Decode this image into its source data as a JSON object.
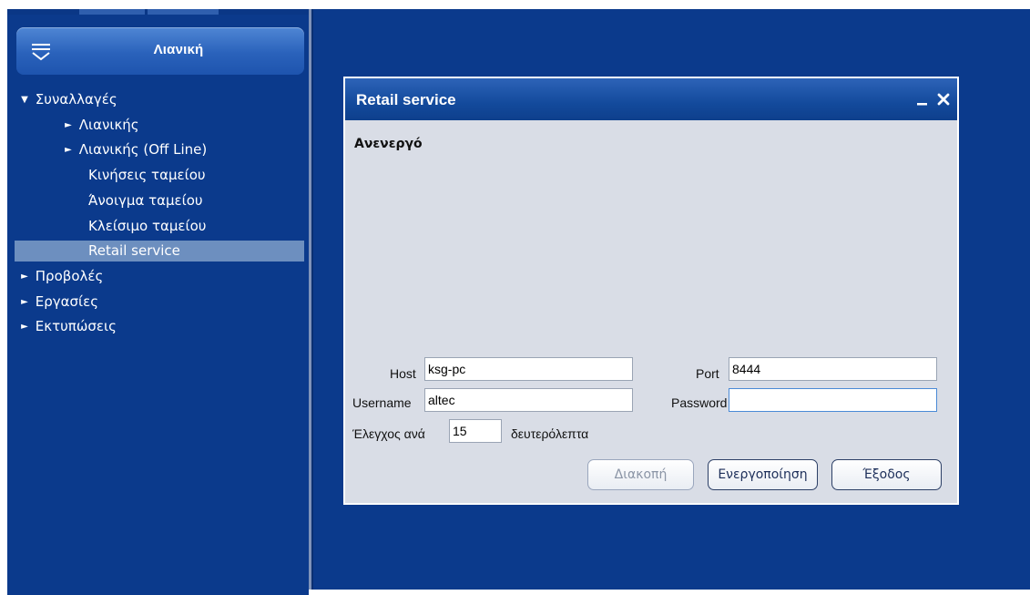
{
  "sidebar": {
    "title": "Λιανική",
    "items": [
      {
        "label": "Συναλλαγές",
        "arrow": "▼"
      },
      {
        "label": "Λιανικής",
        "arrow": "►"
      },
      {
        "label": "Λιανικής (Off Line)",
        "arrow": "►"
      },
      {
        "label": "Κινήσεις ταμείου",
        "arrow": ""
      },
      {
        "label": "Άνοιγμα ταμείου",
        "arrow": ""
      },
      {
        "label": "Κλείσιμο ταμείου",
        "arrow": ""
      },
      {
        "label": "Retail service",
        "arrow": "",
        "selected": true
      },
      {
        "label": "Προβολές",
        "arrow": "►"
      },
      {
        "label": "Εργασίες",
        "arrow": "►"
      },
      {
        "label": "Εκτυπώσεις",
        "arrow": "►"
      }
    ]
  },
  "dialog": {
    "title": "Retail service",
    "minimize_glyph": "_",
    "close_glyph": "✕",
    "status": "Ανενεργό",
    "host_label": "Host",
    "host_value": "ksg-pc",
    "port_label": "Port",
    "port_value": "8444",
    "username_label": "Username",
    "username_value": "altec",
    "password_label": "Password",
    "password_value": "",
    "interval_label": "Έλεγχος ανά",
    "interval_value": "15",
    "interval_unit": "δευτερόλεπτα",
    "buttons": {
      "stop": "Διακοπή",
      "activate": "Ενεργοποίηση",
      "exit": "Έξοδος"
    }
  },
  "colors": {
    "background": "#0b3a8c",
    "header_gradient_top": "#4f86d4",
    "selected_row": "#6d8fbf",
    "dialog_body": "#d9dde6"
  }
}
